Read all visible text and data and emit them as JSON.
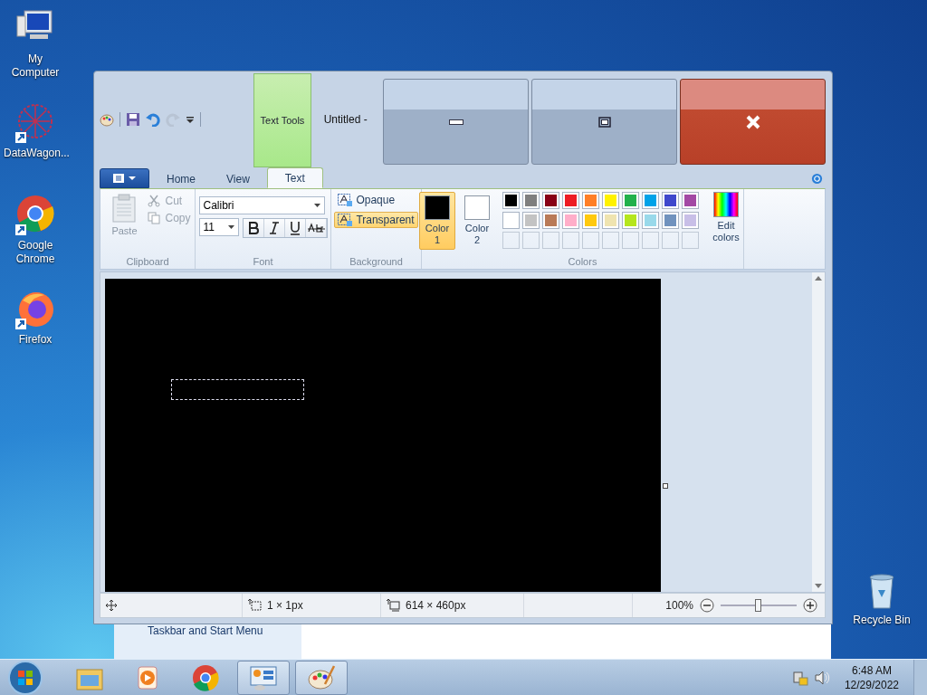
{
  "desktop_icons": [
    {
      "kind": "computer",
      "label": "My Computer"
    },
    {
      "kind": "datawagon",
      "label": "DataWagon..."
    },
    {
      "kind": "chrome",
      "label": "Google Chrome"
    },
    {
      "kind": "firefox",
      "label": "Firefox"
    },
    {
      "kind": "recycle",
      "label": "Recycle Bin"
    }
  ],
  "background_window": {
    "sidebar_link": "Taskbar and Start Menu"
  },
  "paint": {
    "contextual_tab": "Text Tools",
    "title": "Untitled -",
    "tabs": [
      {
        "label": "Home",
        "selected": false
      },
      {
        "label": "View",
        "selected": false
      },
      {
        "label": "Text",
        "selected": true
      }
    ],
    "clipboard": {
      "paste": "Paste",
      "cut": "Cut",
      "copy": "Copy",
      "label": "Clipboard"
    },
    "font": {
      "family": "Calibri",
      "size": "11",
      "label": "Font"
    },
    "background": {
      "label": "Background",
      "options": [
        {
          "label": "Opaque",
          "selected": false
        },
        {
          "label": "Transparent",
          "selected": true
        }
      ]
    },
    "colors": {
      "label": "Colors",
      "edit": "Edit colors",
      "slots": [
        {
          "label": "Color 1",
          "color": "#000000",
          "selected": true
        },
        {
          "label": "Color 2",
          "color": "#ffffff",
          "selected": false
        }
      ],
      "palette": [
        {
          "color": "#000000"
        },
        {
          "color": "#7f7f7f"
        },
        {
          "color": "#880015"
        },
        {
          "color": "#ed1c24"
        },
        {
          "color": "#ff7f27"
        },
        {
          "color": "#fff200"
        },
        {
          "color": "#22b14c"
        },
        {
          "color": "#00a2e8"
        },
        {
          "color": "#3f48cc"
        },
        {
          "color": "#a349a4"
        },
        {
          "color": "#ffffff"
        },
        {
          "color": "#c3c3c3"
        },
        {
          "color": "#b97a57"
        },
        {
          "color": "#ffaec9"
        },
        {
          "color": "#ffc90e"
        },
        {
          "color": "#efe4b0"
        },
        {
          "color": "#b5e61d"
        },
        {
          "color": "#99d9ea"
        },
        {
          "color": "#7092be"
        },
        {
          "color": "#c8bfe7"
        }
      ]
    },
    "status": {
      "selection": "1 × 1px",
      "canvas_size": "614 × 460px",
      "zoom": "100%",
      "zoom_level": {
        "level": 0.5
      }
    }
  },
  "taskbar": {
    "items": [
      {
        "kind": "folder",
        "selected": false
      },
      {
        "kind": "media",
        "selected": false
      },
      {
        "kind": "chrome",
        "selected": false
      },
      {
        "kind": "panel",
        "selected": true
      },
      {
        "kind": "paint",
        "selected": true
      }
    ],
    "time": "6:48 AM",
    "date": "12/29/2022"
  }
}
